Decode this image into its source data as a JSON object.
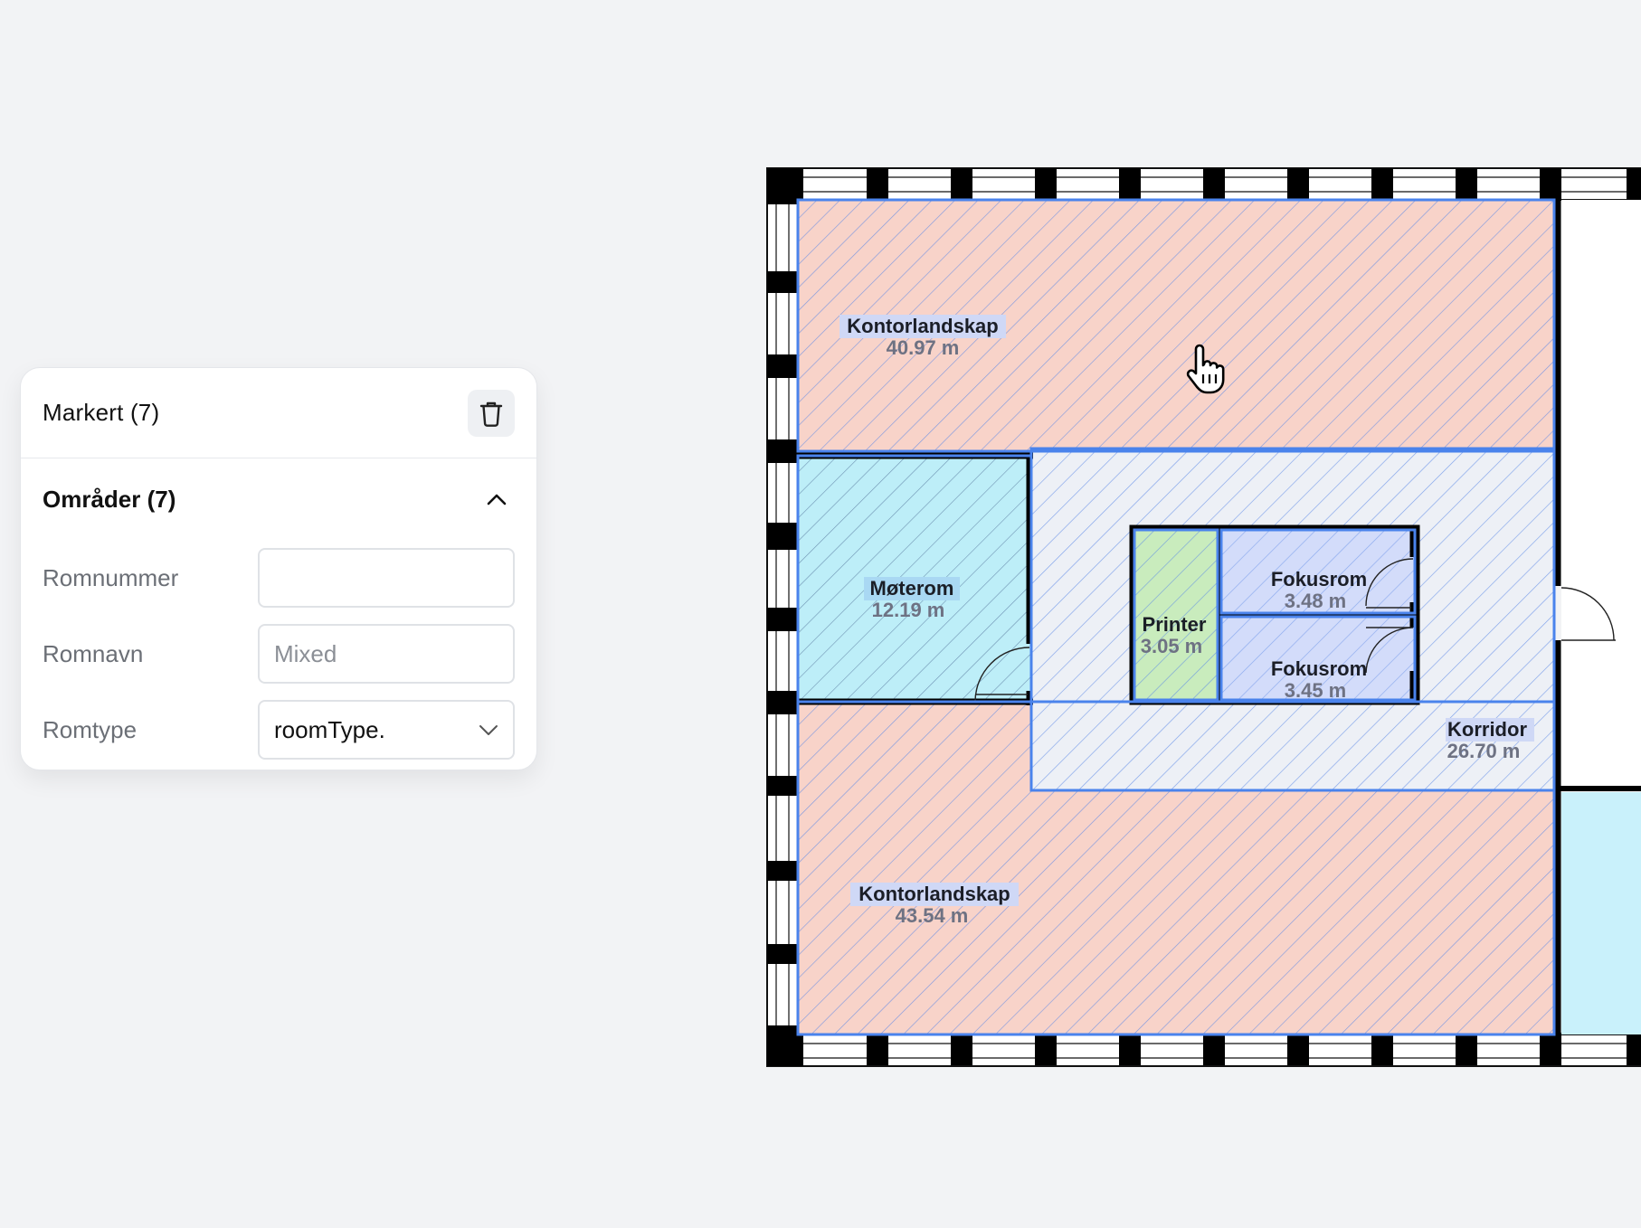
{
  "panel": {
    "title": "Markert (7)",
    "section": {
      "title": "Områder (7)",
      "fields": [
        {
          "label": "Romnummer",
          "value": "",
          "placeholder": ""
        },
        {
          "label": "Romnavn",
          "value": "",
          "placeholder": "Mixed"
        },
        {
          "label": "Romtype",
          "value": "roomType."
        }
      ]
    }
  },
  "floorplan": {
    "rooms": [
      {
        "name": "Kontorlandskap",
        "area": "40.97 m",
        "color": "#f8d3c9"
      },
      {
        "name": "Møterom",
        "area": "12.19 m",
        "color": "#bdeef8"
      },
      {
        "name": "Printer",
        "area": "3.05 m",
        "color": "#c9ecbd"
      },
      {
        "name": "Fokusrom",
        "area": "3.48 m",
        "color": "#d3dcfa"
      },
      {
        "name": "Fokusrom",
        "area": "3.45 m",
        "color": "#d3dcfa"
      },
      {
        "name": "Korridor",
        "area": "26.70 m",
        "color": "#edf0f6"
      },
      {
        "name": "Kontorlandskap",
        "area": "43.54 m",
        "color": "#f8d3c9"
      }
    ],
    "selection_color": "#4a83ec"
  },
  "icons": {
    "delete": "trash-icon",
    "collapse": "chevron-up-icon",
    "dropdown": "chevron-down-icon",
    "pointer": "hand-pointer-icon"
  }
}
